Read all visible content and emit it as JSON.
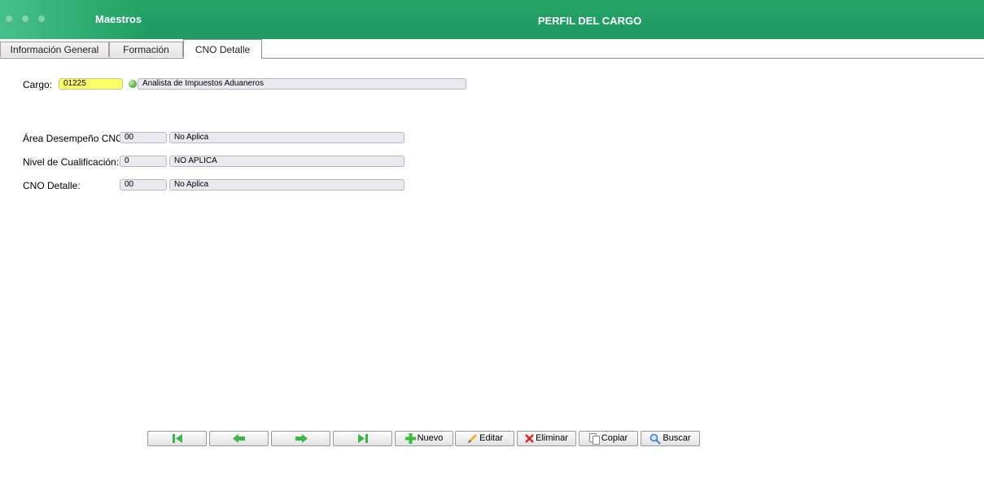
{
  "header": {
    "app_title": "Maestros",
    "window_title": "PERFIL DEL CARGO"
  },
  "tabs": [
    {
      "label": "Información General",
      "active": false
    },
    {
      "label": "Formación",
      "active": false
    },
    {
      "label": "CNO Detalle",
      "active": true
    }
  ],
  "form": {
    "cargo": {
      "label": "Cargo:",
      "code": "01225",
      "description": "Analista de Impuestos Aduaneros"
    },
    "area": {
      "label": "Área Desempeño CNO:",
      "code": "00",
      "description": "No Aplica"
    },
    "nivel": {
      "label": "Nivel de Cualificación:",
      "code": "0",
      "description": "NO APLICA"
    },
    "cno": {
      "label": "CNO Detalle:",
      "code": "00",
      "description": "No Aplica"
    }
  },
  "toolbar": {
    "first": "first-record-icon",
    "prev": "previous-record-icon",
    "next": "next-record-icon",
    "last": "last-record-icon",
    "nuevo": "Nuevo",
    "editar": "Editar",
    "eliminar": "Eliminar",
    "copiar": "Copiar",
    "buscar": "Buscar"
  },
  "colors": {
    "header_green": "#1f9b62",
    "field_yellow": "#ffff66",
    "field_gray": "#e9e9ef",
    "nav_arrow_green": "#39b64a",
    "delete_red": "#e02020"
  }
}
